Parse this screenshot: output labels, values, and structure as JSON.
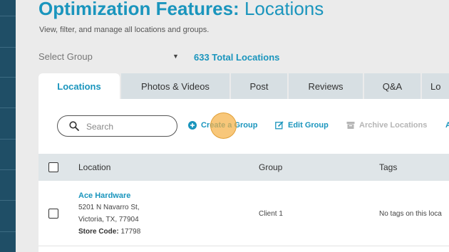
{
  "header": {
    "title_bold": "Optimization Features:",
    "title_light": "Locations",
    "subtitle": "View, filter, and manage all locations and groups."
  },
  "group_select": {
    "label": "Select Group"
  },
  "total_locations": "633 Total Locations",
  "tabs": [
    {
      "label": "Locations",
      "active": true
    },
    {
      "label": "Photos & Videos"
    },
    {
      "label": "Post"
    },
    {
      "label": "Reviews"
    },
    {
      "label": "Q&A"
    },
    {
      "label": "Lo"
    }
  ],
  "toolbar": {
    "search_placeholder": "Search",
    "create_group": "Create a Group",
    "edit_group": "Edit Group",
    "archive_locations": "Archive Locations",
    "more": "A"
  },
  "table": {
    "columns": [
      "Location",
      "Group",
      "Tags"
    ],
    "rows": [
      {
        "name": "Ace Hardware",
        "address_line1": "5201 N Navarro St,",
        "address_line2": "Victoria, TX, 77904",
        "store_code_label": "Store Code:",
        "store_code": "17798",
        "group": "Client 1",
        "tags": "No tags on this loca"
      }
    ]
  },
  "colors": {
    "accent": "#1a95bd",
    "sidebar": "#1f4e66",
    "tab_inactive": "#d7dfe3",
    "table_header": "#dfe5e8"
  }
}
